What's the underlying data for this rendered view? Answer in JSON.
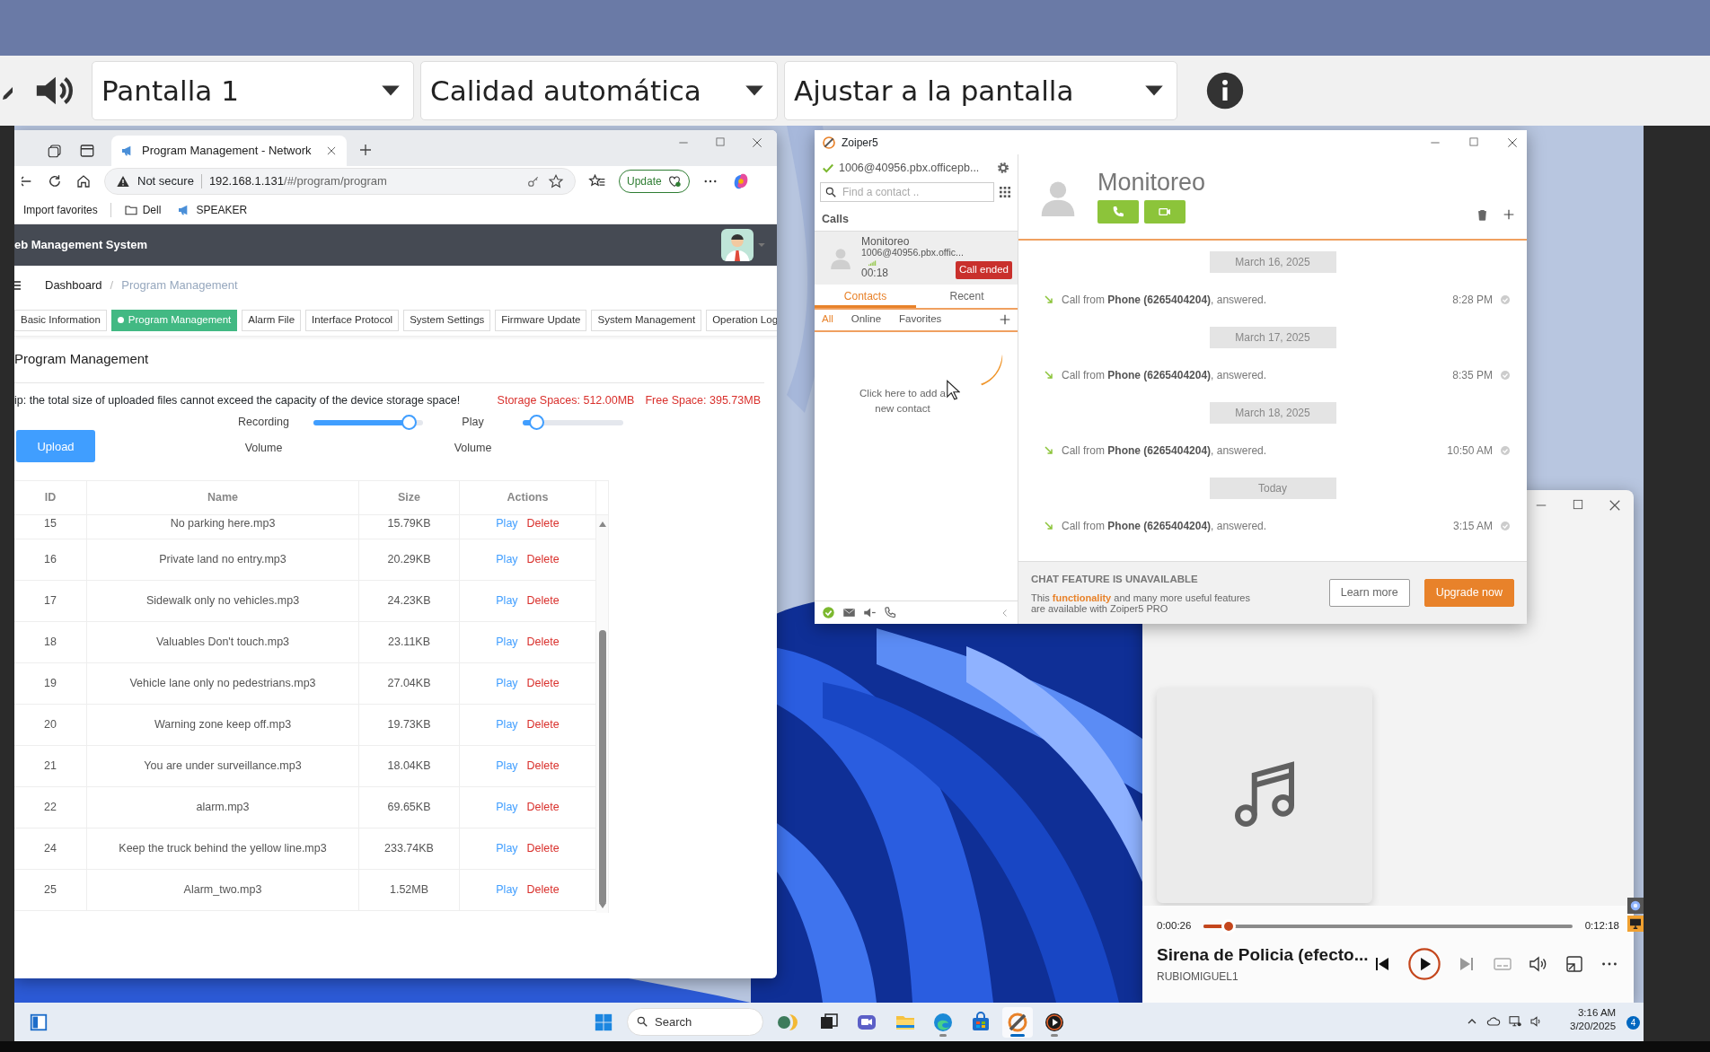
{
  "viewer": {
    "selects": [
      {
        "value": "Pantalla 1"
      },
      {
        "value": "Calidad automática"
      },
      {
        "value": "Ajustar a la pantalla"
      }
    ]
  },
  "browser": {
    "tabs": [
      {
        "title": "Program Management - Network",
        "selected": true
      }
    ],
    "address": {
      "security": "Not secure",
      "host": "192.168.1.131",
      "path": "/#/program/program"
    },
    "update_button": "Update",
    "favorites": [
      {
        "kind": "text",
        "label": "Import favorites"
      },
      {
        "kind": "folder",
        "label": "Dell"
      },
      {
        "kind": "site",
        "label": "SPEAKER"
      }
    ],
    "page": {
      "app_title": "eb Management System",
      "breadcrumb": [
        {
          "label": "Dashboard",
          "current": false
        },
        {
          "label": "Program Management",
          "current": true
        }
      ],
      "breadcrumb_separator": "/",
      "tabs": [
        {
          "label": "Basic Information",
          "selected": false
        },
        {
          "label": "Program Management",
          "selected": true
        },
        {
          "label": "Alarm File",
          "selected": false
        },
        {
          "label": "Interface Protocol",
          "selected": false
        },
        {
          "label": "System Settings",
          "selected": false
        },
        {
          "label": "Firmware Update",
          "selected": false
        },
        {
          "label": "System Management",
          "selected": false
        },
        {
          "label": "Operation Log",
          "selected": false
        }
      ],
      "section_title": "Program Management",
      "tip": "ip: the total size of uploaded files cannot exceed the capacity of the device storage space!",
      "storage": "Storage Spaces: 512.00MB",
      "free_space": "Free Space: 395.73MB",
      "sliders": [
        {
          "label": "Recording",
          "sublabel": "Volume",
          "level": 0.93
        },
        {
          "label": "Play",
          "sublabel": "Volume",
          "level": 0.07
        }
      ],
      "upload_button": "Upload",
      "table": {
        "columns": [
          "ID",
          "Name",
          "Size",
          "Actions"
        ],
        "rows": [
          {
            "id": "15",
            "name": "No parking here.mp3",
            "size": "15.79KB",
            "play": "Play",
            "delete": "Delete"
          },
          {
            "id": "16",
            "name": "Private land no entry.mp3",
            "size": "20.29KB",
            "play": "Play",
            "delete": "Delete"
          },
          {
            "id": "17",
            "name": "Sidewalk only no vehicles.mp3",
            "size": "24.23KB",
            "play": "Play",
            "delete": "Delete"
          },
          {
            "id": "18",
            "name": "Valuables Don't touch.mp3",
            "size": "23.11KB",
            "play": "Play",
            "delete": "Delete"
          },
          {
            "id": "19",
            "name": "Vehicle lane only no pedestrians.mp3",
            "size": "27.04KB",
            "play": "Play",
            "delete": "Delete"
          },
          {
            "id": "20",
            "name": "Warning zone keep off.mp3",
            "size": "19.73KB",
            "play": "Play",
            "delete": "Delete"
          },
          {
            "id": "21",
            "name": "You are under surveillance.mp3",
            "size": "18.04KB",
            "play": "Play",
            "delete": "Delete"
          },
          {
            "id": "22",
            "name": "alarm.mp3",
            "size": "69.65KB",
            "play": "Play",
            "delete": "Delete"
          },
          {
            "id": "24",
            "name": "Keep the truck behind the yellow line.mp3",
            "size": "233.74KB",
            "play": "Play",
            "delete": "Delete"
          },
          {
            "id": "25",
            "name": "Alarm_two.mp3",
            "size": "1.52MB",
            "play": "Play",
            "delete": "Delete"
          }
        ]
      }
    }
  },
  "zoiper": {
    "title": "Zoiper5",
    "account": "1006@40956.pbx.officepb...",
    "search": {
      "placeholder": "Find a contact .."
    },
    "calls_heading": "Calls",
    "calls": [
      {
        "name": "Monitoreo",
        "address": "1006@40956.pbx.offic...",
        "duration": "00:18",
        "status": "Call ended"
      }
    ],
    "tabs": [
      {
        "label": "Contacts",
        "selected": true
      },
      {
        "label": "Recent",
        "selected": false
      }
    ],
    "filters": [
      {
        "label": "All",
        "selected": true
      },
      {
        "label": "Online",
        "selected": false
      },
      {
        "label": "Favorites",
        "selected": false
      }
    ],
    "empty_hint": "Click here to add a new contact",
    "contact": {
      "name": "Monitoreo"
    },
    "history": [
      {
        "kind": "date",
        "label": "March 16, 2025"
      },
      {
        "kind": "call",
        "text": "Call from **Phone (6265404204)**, answered.",
        "time": "8:28 PM"
      },
      {
        "kind": "date",
        "label": "March 17, 2025"
      },
      {
        "kind": "call",
        "text": "Call from **Phone (6265404204)**, answered.",
        "time": "8:35 PM"
      },
      {
        "kind": "date",
        "label": "March 18, 2025"
      },
      {
        "kind": "call",
        "text": "Call from **Phone (6265404204)**, answered.",
        "time": "10:50 AM"
      },
      {
        "kind": "date",
        "label": "Today"
      },
      {
        "kind": "call",
        "text": "Call from **Phone (6265404204)**, answered.",
        "time": "3:15 AM"
      }
    ],
    "promo": {
      "title": "CHAT FEATURE IS UNAVAILABLE",
      "text": "This **functionality** and many more useful features are available with Zoiper5 PRO",
      "buttons": [
        {
          "label": "Learn more",
          "kind": "secondary"
        },
        {
          "label": "Upgrade now",
          "kind": "primary"
        }
      ]
    }
  },
  "media_player": {
    "title": "Sirena de Policia (efecto...",
    "artist": "RUBIOMIGUEL1",
    "elapsed": "0:00:26",
    "duration": "0:12:18",
    "progress": {
      "level": 0.05
    },
    "playing": false
  },
  "taskbar": {
    "search": {
      "placeholder": "Search"
    },
    "apps": [
      {
        "kind": "weather",
        "running": false,
        "selected": false
      },
      {
        "kind": "taskview",
        "running": false,
        "selected": false
      },
      {
        "kind": "meet",
        "running": false,
        "selected": false
      },
      {
        "kind": "explorer",
        "running": false,
        "selected": false
      },
      {
        "kind": "edge",
        "running": true,
        "selected": false
      },
      {
        "kind": "store",
        "running": false,
        "selected": false
      },
      {
        "kind": "zoiper",
        "running": true,
        "selected": true
      },
      {
        "kind": "media",
        "running": true,
        "selected": false
      }
    ],
    "clock": {
      "time": "3:16 AM",
      "date": "3/20/2025"
    },
    "notifications": "4"
  }
}
